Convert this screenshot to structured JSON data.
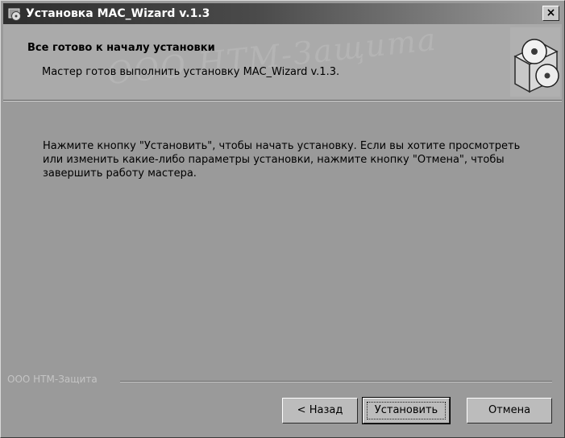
{
  "window": {
    "title": "Установка MAC_Wizard v.1.3",
    "close_label": "×"
  },
  "header": {
    "title": "Все готово к началу установки",
    "subtitle": "Мастер готов выполнить установку MAC_Wizard v.1.3.",
    "watermark": "ООО НТМ-Защита"
  },
  "body": {
    "text": "Нажмите кнопку \"Установить\", чтобы начать установку. Если вы хотите просмотреть или изменить какие-либо параметры установки, нажмите кнопку \"Отмена\", чтобы завершить работу мастера."
  },
  "footer": {
    "brand": "ООО НТМ-Защита"
  },
  "buttons": {
    "back_label": "< Назад",
    "install_label": "Установить",
    "cancel_label": "Отмена"
  },
  "icons": {
    "app": "setup-icon",
    "header_graphic": "installer-box-cd-icon"
  }
}
